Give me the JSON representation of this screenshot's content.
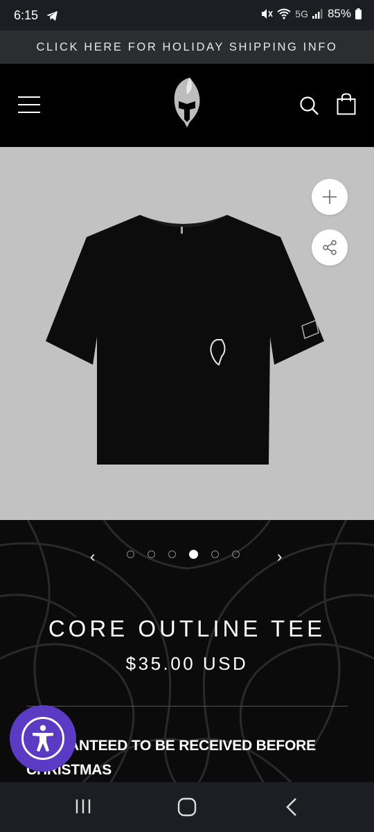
{
  "status_bar": {
    "time": "6:15",
    "network": "5G",
    "battery": "85%"
  },
  "promo_banner": {
    "text": "CLICK HERE FOR HOLIDAY SHIPPING INFO"
  },
  "header": {
    "menu_icon": "hamburger-icon",
    "logo": "spartan-helmet-logo",
    "search_icon": "search-icon",
    "cart_icon": "shopping-bag-icon"
  },
  "gallery": {
    "image": "black-tshirt-with-helmet-logo",
    "actions": [
      "plus-icon",
      "share-icon"
    ],
    "prev_label": "‹",
    "next_label": "›",
    "slide_count": 6,
    "active_index": 3
  },
  "product": {
    "title": "CORE OUTLINE TEE",
    "price": "$35.00 USD",
    "notice": "GUARANTEED TO BE RECEIVED BEFORE CHRISTMAS"
  },
  "colors": {
    "hero_bg": "#c2c2c2",
    "accessibility_button": "#5b3bc4"
  }
}
